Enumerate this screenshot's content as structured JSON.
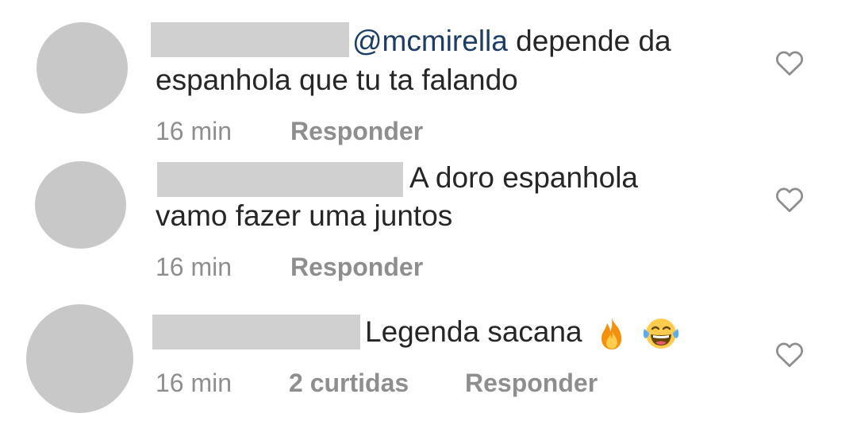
{
  "comments": [
    {
      "mention": "@mcmirella",
      "text_line1": "depende da",
      "text_line2": "espanhola que tu ta falando",
      "time": "16 min",
      "reply_label": "Responder",
      "heart_icon": "heart-outline-icon"
    },
    {
      "text_line1": "A doro espanhola",
      "text_line2": "vamo fazer uma juntos",
      "time": "16 min",
      "reply_label": "Responder",
      "heart_icon": "heart-outline-icon"
    },
    {
      "text_line1": "Legenda sacana",
      "emojis": [
        "fire-emoji",
        "laughing-tears-emoji"
      ],
      "time": "16 min",
      "likes": "2 curtidas",
      "reply_label": "Responder",
      "heart_icon": "heart-outline-icon"
    }
  ],
  "colors": {
    "text": "#262626",
    "meta": "#8e8e8e",
    "mention": "#1c3d66",
    "avatar_placeholder": "#c8c8c8",
    "username_redaction": "#d0d0d0"
  }
}
